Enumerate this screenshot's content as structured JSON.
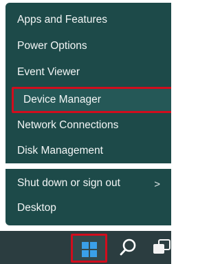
{
  "context_menu": {
    "items": [
      {
        "label": "Apps and Features"
      },
      {
        "label": "Power Options"
      },
      {
        "label": "Event Viewer"
      },
      {
        "label": "Device Manager"
      },
      {
        "label": "Network Connections"
      },
      {
        "label": "Disk Management"
      },
      {
        "label": "Shut down or sign out",
        "submenu_indicator": ">"
      },
      {
        "label": "Desktop"
      }
    ]
  },
  "taskbar": {
    "icons": [
      "windows-start-icon",
      "search-icon",
      "task-view-icon"
    ]
  },
  "colors": {
    "menu_background": "#1d4a49",
    "highlight_border": "#d10d1d",
    "taskbar_background": "#2b3d40",
    "start_icon_blue": "#3aa0e8",
    "text": "#f3f6f6"
  }
}
